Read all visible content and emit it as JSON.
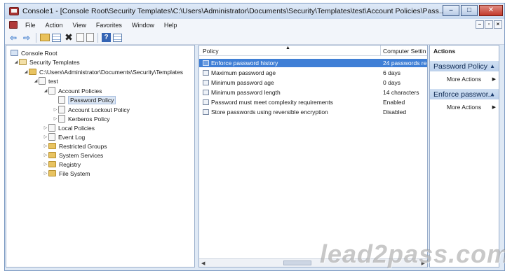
{
  "window": {
    "title": "Console1 - [Console Root\\Security Templates\\C:\\Users\\Administrator\\Documents\\Security\\Templates\\test\\Account Policies\\Pass...",
    "minimize": "–",
    "maximize": "□",
    "close": "✕"
  },
  "menu": {
    "items": [
      "File",
      "Action",
      "View",
      "Favorites",
      "Window",
      "Help"
    ],
    "mdi": [
      "–",
      "▫",
      "×"
    ]
  },
  "toolbar": {
    "icons": [
      "back-arrow-icon",
      "forward-arrow-icon",
      "up-folder-icon",
      "show-hide-tree-icon",
      "delete-icon",
      "properties-icon",
      "export-list-icon",
      "help-icon",
      "show-hide-action-pane-icon"
    ]
  },
  "tree": {
    "items": [
      {
        "label": "Console Root",
        "level": 0
      },
      {
        "label": "Security Templates",
        "level": 1
      },
      {
        "label": "C:\\Users\\Administrator\\Documents\\Security\\Templates",
        "level": 2
      },
      {
        "label": "test",
        "level": 3
      },
      {
        "label": "Account Policies",
        "level": 4
      },
      {
        "label": "Password Policy",
        "level": 5,
        "selected": true
      },
      {
        "label": "Account Lockout Policy",
        "level": 5
      },
      {
        "label": "Kerberos Policy",
        "level": 5
      },
      {
        "label": "Local Policies",
        "level": 4
      },
      {
        "label": "Event Log",
        "level": 4
      },
      {
        "label": "Restricted Groups",
        "level": 4
      },
      {
        "label": "System Services",
        "level": 4
      },
      {
        "label": "Registry",
        "level": 4
      },
      {
        "label": "File System",
        "level": 4
      }
    ]
  },
  "list": {
    "columns": [
      "Policy",
      "Computer Settin"
    ],
    "rows": [
      {
        "policy": "Enforce password history",
        "setting": "24 passwords re",
        "selected": true
      },
      {
        "policy": "Maximum password age",
        "setting": "6 days"
      },
      {
        "policy": "Minimum password age",
        "setting": "0 days"
      },
      {
        "policy": "Minimum password length",
        "setting": "14 characters"
      },
      {
        "policy": "Password must meet complexity requirements",
        "setting": "Enabled"
      },
      {
        "policy": "Store passwords using reversible encryption",
        "setting": "Disabled"
      }
    ]
  },
  "actions": {
    "title": "Actions",
    "sections": [
      {
        "label": "Password Policy",
        "item": "More Actions"
      },
      {
        "label": "Enforce passwor...",
        "item": "More Actions"
      }
    ]
  },
  "watermark": "lead2pass.com"
}
